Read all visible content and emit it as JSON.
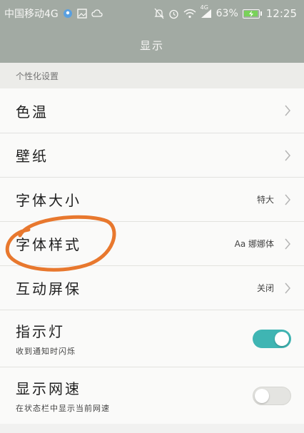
{
  "status_bar": {
    "carrier": "中国移动4G",
    "battery_percent": "63%",
    "network_type": "4G",
    "time": "12:25",
    "icons_left": [
      "location-bubble-icon",
      "image-icon",
      "cloud-icon"
    ],
    "icons_right": [
      "mute-icon",
      "alarm-icon",
      "wifi-icon",
      "signal-icon",
      "battery-charging-icon"
    ],
    "battery_level": 0.63
  },
  "header": {
    "title": "显示"
  },
  "section": {
    "title": "个性化设置"
  },
  "rows": [
    {
      "label": "色温",
      "value": "",
      "type": "link"
    },
    {
      "label": "壁纸",
      "value": "",
      "type": "link"
    },
    {
      "label": "字体大小",
      "value": "特大",
      "type": "link"
    },
    {
      "label": "字体样式",
      "value": "Aa 娜娜体",
      "type": "link"
    },
    {
      "label": "互动屏保",
      "value": "关闭",
      "type": "link"
    },
    {
      "label": "指示灯",
      "sublabel": "收到通知时闪烁",
      "type": "toggle",
      "toggle_on": true
    },
    {
      "label": "显示网速",
      "sublabel": "在状态栏中显示当前网速",
      "type": "toggle",
      "toggle_on": false
    }
  ],
  "colors": {
    "header_bg": "#a2aaa3",
    "toggle_on": "#3fb5b3",
    "annotation_circle": "#e8782e"
  }
}
